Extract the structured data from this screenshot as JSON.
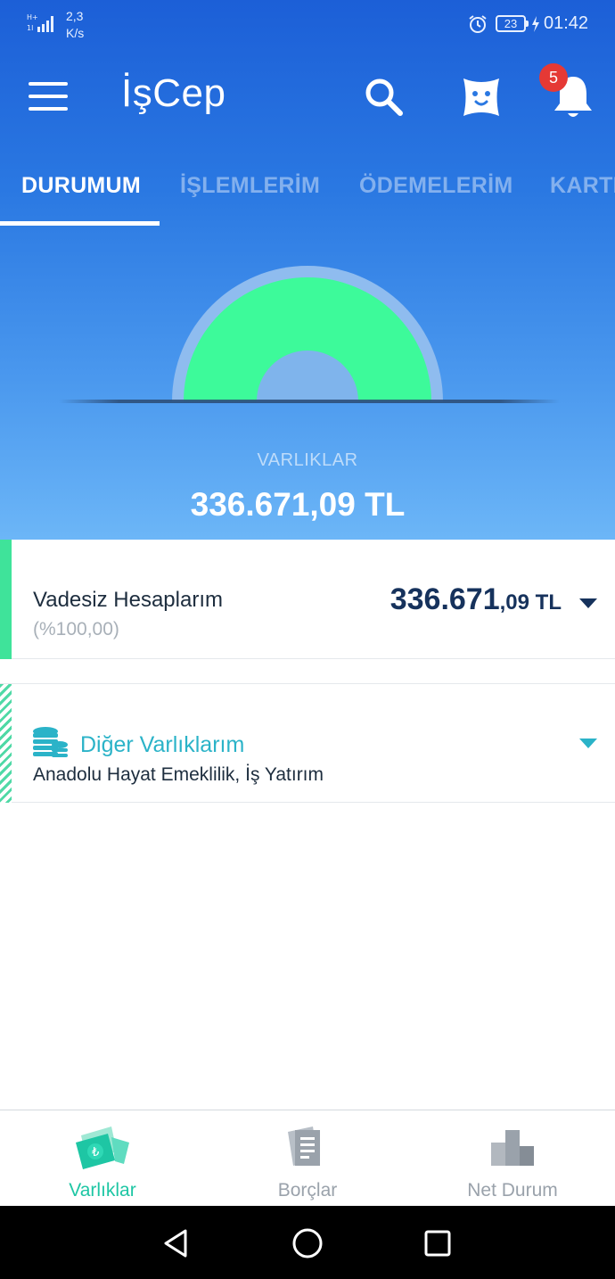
{
  "status_bar": {
    "network_speed_value": "2,3",
    "network_speed_unit": "K/s",
    "battery": "23",
    "time": "01:42"
  },
  "app_bar": {
    "title": "İşCep",
    "notification_count": "5"
  },
  "tabs": [
    {
      "label": "DURUMUM",
      "active": true
    },
    {
      "label": "İŞLEMLERİM",
      "active": false
    },
    {
      "label": "ÖDEMELERİM",
      "active": false
    },
    {
      "label": "KARTL",
      "active": false
    }
  ],
  "summary": {
    "label": "VARLIKLAR",
    "total": "336.671,09 TL",
    "gauge_fill_fraction": 1.0,
    "gauge_color": "#3dfa9a"
  },
  "accounts": {
    "demand": {
      "title": "Vadesiz Hesaplarım",
      "percent": "(%100,00)",
      "amount_int": "336.671",
      "amount_dec": ",09",
      "currency": " TL"
    },
    "other": {
      "title": "Diğer Varlıklarım",
      "subtitle": "Anadolu Hayat Emeklilik, İş Yatırım"
    }
  },
  "bottom_nav": [
    {
      "label": "Varlıklar",
      "icon": "banknotes-icon",
      "active": true
    },
    {
      "label": "Borçlar",
      "icon": "receipts-icon",
      "active": false
    },
    {
      "label": "Net Durum",
      "icon": "bars-icon",
      "active": false
    }
  ],
  "colors": {
    "accent_green": "#3fe39a",
    "accent_teal": "#2bb3c8",
    "amount_navy": "#16325c",
    "header_blue": "#2a78e2"
  }
}
